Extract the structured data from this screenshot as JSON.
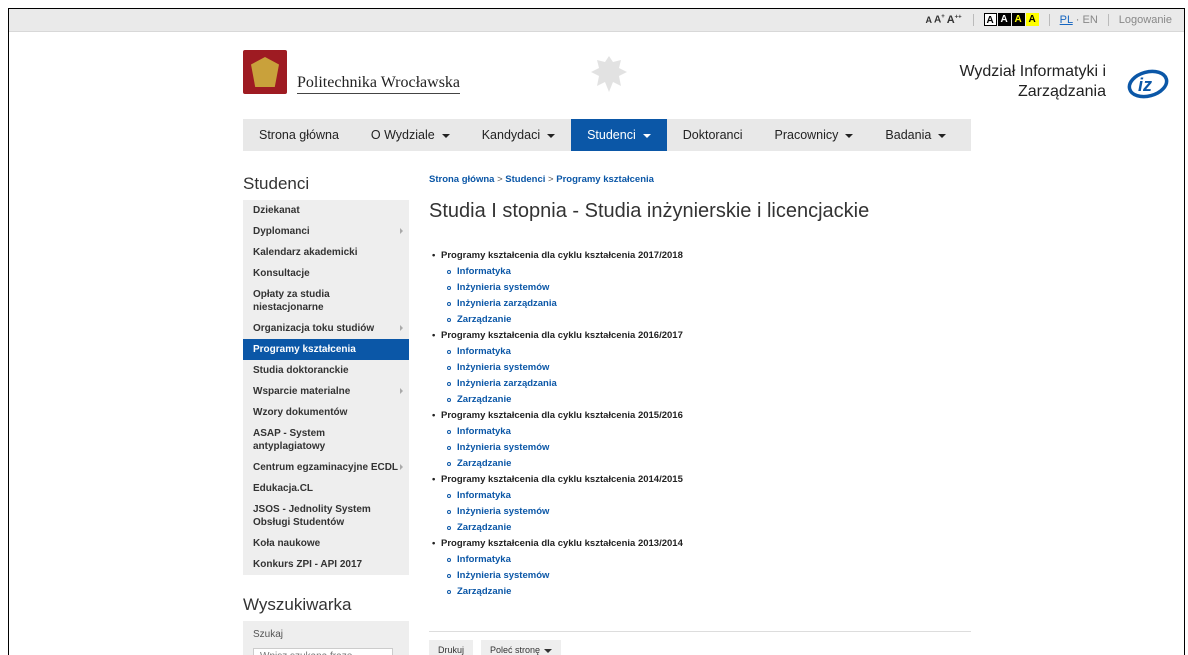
{
  "topbar": {
    "font_small": "A",
    "font_medium": "A",
    "font_large": "A",
    "contrast": [
      "A",
      "A",
      "A",
      "A"
    ],
    "lang_pl": "PL",
    "lang_sep": " · ",
    "lang_en": "EN",
    "login": "Logowanie"
  },
  "header": {
    "university": "Politechnika Wrocławska",
    "faculty_line1": "Wydział Informatyki i",
    "faculty_line2": "Zarządzania"
  },
  "nav": [
    {
      "label": "Strona główna",
      "dropdown": false,
      "active": false
    },
    {
      "label": "O Wydziale",
      "dropdown": true,
      "active": false
    },
    {
      "label": "Kandydaci",
      "dropdown": true,
      "active": false
    },
    {
      "label": "Studenci",
      "dropdown": true,
      "active": true
    },
    {
      "label": "Doktoranci",
      "dropdown": false,
      "active": false
    },
    {
      "label": "Pracownicy",
      "dropdown": true,
      "active": false
    },
    {
      "label": "Badania",
      "dropdown": true,
      "active": false
    }
  ],
  "sidebar": {
    "title": "Studenci",
    "items": [
      {
        "label": "Dziekanat",
        "arrow": false,
        "active": false
      },
      {
        "label": "Dyplomanci",
        "arrow": true,
        "active": false
      },
      {
        "label": "Kalendarz akademicki",
        "arrow": false,
        "active": false
      },
      {
        "label": "Konsultacje",
        "arrow": false,
        "active": false
      },
      {
        "label": "Opłaty za studia niestacjonarne",
        "arrow": false,
        "active": false
      },
      {
        "label": "Organizacja toku studiów",
        "arrow": true,
        "active": false
      },
      {
        "label": "Programy kształcenia",
        "arrow": false,
        "active": true
      },
      {
        "label": "Studia doktoranckie",
        "arrow": false,
        "active": false
      },
      {
        "label": "Wsparcie materialne",
        "arrow": true,
        "active": false
      },
      {
        "label": "Wzory dokumentów",
        "arrow": false,
        "active": false
      },
      {
        "label": "ASAP - System antyplagiatowy",
        "arrow": false,
        "active": false
      },
      {
        "label": "Centrum egzaminacyjne ECDL",
        "arrow": true,
        "active": false
      },
      {
        "label": "Edukacja.CL",
        "arrow": false,
        "active": false
      },
      {
        "label": "JSOS - Jednolity System Obsługi Studentów",
        "arrow": false,
        "active": false
      },
      {
        "label": "Koła naukowe",
        "arrow": false,
        "active": false
      },
      {
        "label": "Konkurs ZPI - API 2017",
        "arrow": false,
        "active": false
      }
    ],
    "search_title": "Wyszukiwarka",
    "search_label": "Szukaj",
    "search_placeholder": "Wpisz szukaną frazę"
  },
  "breadcrumb": [
    "Strona główna",
    "Studenci",
    "Programy kształcenia"
  ],
  "breadcrumb_sep": " > ",
  "page_title": "Studia I stopnia - Studia inżynierskie i licencjackie",
  "cycles": [
    {
      "label": "Programy kształcenia dla cyklu kształcenia 2017/2018",
      "programs": [
        "Informatyka",
        "Inżynieria systemów",
        "Inżynieria zarządzania",
        "Zarządzanie"
      ]
    },
    {
      "label": "Programy kształcenia dla cyklu kształcenia 2016/2017",
      "programs": [
        "Informatyka",
        "Inżynieria systemów",
        "Inżynieria zarządzania",
        "Zarządzanie"
      ]
    },
    {
      "label": "Programy kształcenia dla cyklu kształcenia 2015/2016",
      "programs": [
        "Informatyka",
        "Inżynieria systemów",
        "Zarządzanie"
      ]
    },
    {
      "label": "Programy kształcenia dla cyklu kształcenia 2014/2015",
      "programs": [
        "Informatyka",
        "Inżynieria systemów",
        "Zarządzanie"
      ]
    },
    {
      "label": "Programy kształcenia dla cyklu kształcenia 2013/2014",
      "programs": [
        "Informatyka",
        "Inżynieria systemów",
        "Zarządzanie"
      ]
    }
  ],
  "actions": {
    "print": "Drukuj",
    "recommend": "Poleć stronę"
  },
  "colors": {
    "accent": "#0b57a7",
    "university_red": "#9e1b22"
  }
}
